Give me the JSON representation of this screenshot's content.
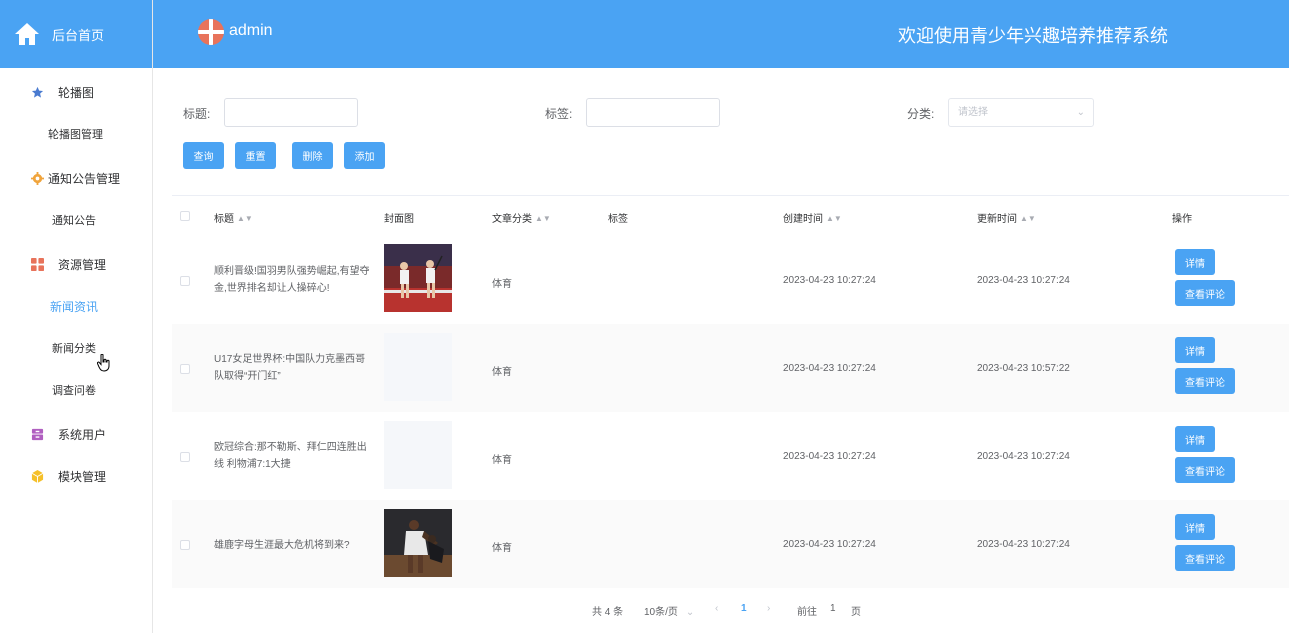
{
  "sidebar": {
    "home_label": "后台首页",
    "groups": [
      {
        "label": "轮播图",
        "icon": "star-icon",
        "color": "#4a7bd0",
        "items": [
          {
            "label": "轮播图管理"
          }
        ]
      },
      {
        "label": "通知公告管理",
        "icon": "gear-icon",
        "color": "#f0a43c",
        "items": [
          {
            "label": "通知公告"
          }
        ]
      },
      {
        "label": "资源管理",
        "icon": "grid-icon",
        "color": "#e8735b",
        "items": [
          {
            "label": "新闻资讯",
            "active": true
          },
          {
            "label": "新闻分类"
          },
          {
            "label": "调查问卷"
          }
        ]
      },
      {
        "label": "系统用户",
        "icon": "archive-icon",
        "color": "#b05fc0",
        "items": []
      },
      {
        "label": "模块管理",
        "icon": "cube-icon",
        "color": "#f5c02a",
        "items": []
      }
    ]
  },
  "header": {
    "username": "admin",
    "title": "欢迎使用青少年兴趣培养推荐系统"
  },
  "search": {
    "title_label": "标题:",
    "title_value": "",
    "tag_label": "标签:",
    "tag_value": "",
    "category_label": "分类:",
    "category_placeholder": "请选择",
    "buttons": {
      "query": "查询",
      "reset": "重置",
      "delete": "删除",
      "add": "添加"
    }
  },
  "table": {
    "headers": {
      "title": "标题",
      "cover": "封面图",
      "category": "文章分类",
      "tags": "标签",
      "created": "创建时间",
      "updated": "更新时间",
      "actions": "操作"
    },
    "rows": [
      {
        "title": "顺利晋级!国羽男队强势崛起,有望夺金,世界排名却让人操碎心!",
        "cover": "badminton-photo",
        "category": "体育",
        "tags": "",
        "created": "2023-04-23 10:27:24",
        "updated": "2023-04-23 10:27:24",
        "detail": "详情",
        "comments": "查看评论"
      },
      {
        "title": "U17女足世界杯:中国队力克墨西哥队取得“开门红”",
        "cover": "",
        "category": "体育",
        "tags": "",
        "created": "2023-04-23 10:27:24",
        "updated": "2023-04-23 10:57:22",
        "detail": "详情",
        "comments": "查看评论"
      },
      {
        "title": "欧冠综合:那不勒斯、拜仁四连胜出线 利物浦7:1大捷",
        "cover": "",
        "category": "体育",
        "tags": "",
        "created": "2023-04-23 10:27:24",
        "updated": "2023-04-23 10:27:24",
        "detail": "详情",
        "comments": "查看评论"
      },
      {
        "title": "雄鹿字母生涯最大危机将到来?",
        "cover": "basketball-photo",
        "category": "体育",
        "tags": "",
        "created": "2023-04-23 10:27:24",
        "updated": "2023-04-23 10:27:24",
        "detail": "详情",
        "comments": "查看评论"
      }
    ]
  },
  "pagination": {
    "total": "共 4 条",
    "page_size": "10条/页",
    "current_page": "1",
    "goto_label": "前往",
    "goto_value": "1",
    "page_suffix": "页"
  },
  "colors": {
    "primary": "#4aa3f3",
    "sidebar_active": "#4aa3f3"
  }
}
